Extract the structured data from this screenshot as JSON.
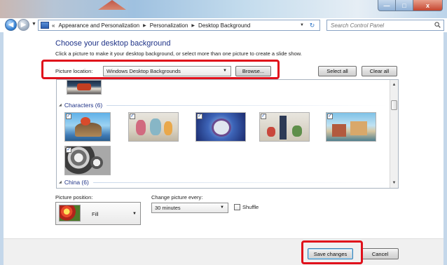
{
  "window": {
    "controls": {
      "minimize": "—",
      "maximize": "□",
      "close": "x"
    }
  },
  "address_bar": {
    "overflow": "«",
    "crumbs": [
      "Appearance and Personalization",
      "Personalization",
      "Desktop Background"
    ],
    "search_placeholder": "Search Control Panel"
  },
  "page": {
    "title": "Choose your desktop background",
    "description": "Click a picture to make it your desktop background, or select more than one picture to create a slide show."
  },
  "picture_location": {
    "label": "Picture location:",
    "value": "Windows Desktop Backgrounds",
    "browse": "Browse..."
  },
  "selection": {
    "select_all": "Select all",
    "clear_all": "Clear all"
  },
  "gallery": {
    "groups": [
      {
        "name": "Characters (6)",
        "count": 6
      },
      {
        "name": "China (6)",
        "count": 6
      }
    ]
  },
  "picture_position": {
    "label": "Picture position:",
    "value": "Fill"
  },
  "change_picture": {
    "label": "Change picture every:",
    "value": "30 minutes"
  },
  "shuffle": {
    "label": "Shuffle",
    "checked": false
  },
  "footer": {
    "save": "Save changes",
    "cancel": "Cancel"
  },
  "colors": {
    "highlight": "#e0101b",
    "heading": "#1e3287"
  }
}
